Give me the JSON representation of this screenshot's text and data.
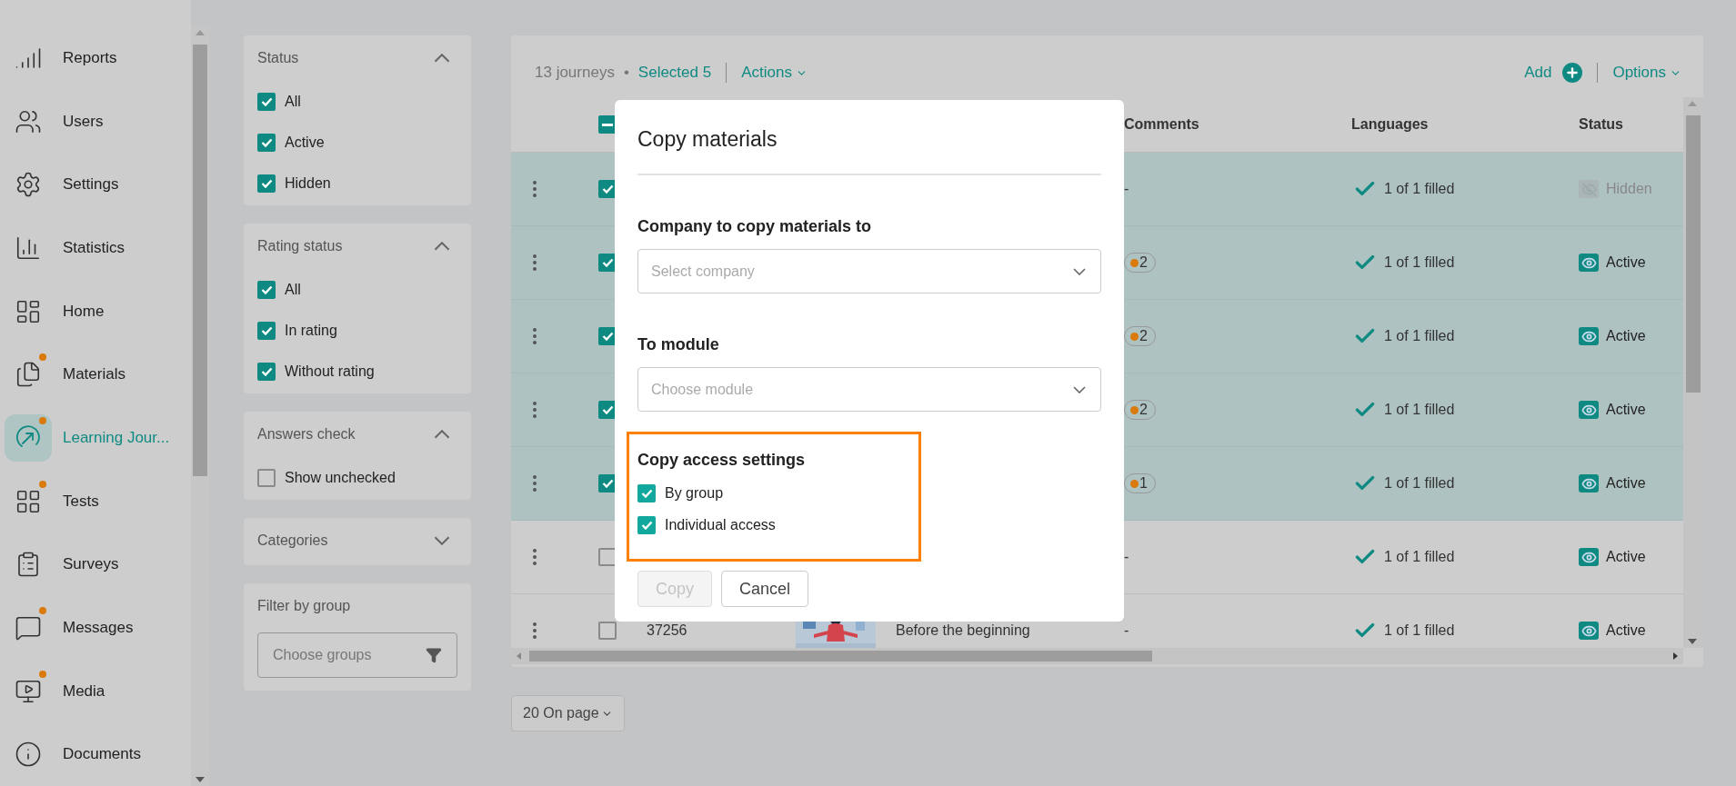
{
  "sidebar": {
    "items": [
      {
        "label": "Reports",
        "active": false,
        "badge": false
      },
      {
        "label": "Users",
        "active": false,
        "badge": false
      },
      {
        "label": "Settings",
        "active": false,
        "badge": false
      },
      {
        "label": "Statistics",
        "active": false,
        "badge": false
      },
      {
        "label": "Home",
        "active": false,
        "badge": false
      },
      {
        "label": "Materials",
        "active": false,
        "badge": true
      },
      {
        "label": "Learning Jour...",
        "active": true,
        "badge": true
      },
      {
        "label": "Tests",
        "active": false,
        "badge": true
      },
      {
        "label": "Surveys",
        "active": false,
        "badge": false
      },
      {
        "label": "Messages",
        "active": false,
        "badge": true
      },
      {
        "label": "Media",
        "active": false,
        "badge": true
      },
      {
        "label": "Documents",
        "active": false,
        "badge": false
      }
    ]
  },
  "filters": [
    {
      "kind": "checklist",
      "title": "Status",
      "expanded": true,
      "options": [
        {
          "label": "All",
          "checked": true
        },
        {
          "label": "Active",
          "checked": true
        },
        {
          "label": "Hidden",
          "checked": true
        }
      ]
    },
    {
      "kind": "checklist",
      "title": "Rating status",
      "expanded": true,
      "options": [
        {
          "label": "All",
          "checked": true
        },
        {
          "label": "In rating",
          "checked": true
        },
        {
          "label": "Without rating",
          "checked": true
        }
      ]
    },
    {
      "kind": "checklist",
      "title": "Answers check",
      "expanded": true,
      "options": [
        {
          "label": "Show unchecked",
          "checked": false
        }
      ]
    },
    {
      "kind": "checklist",
      "title": "Categories",
      "expanded": false
    },
    {
      "kind": "field",
      "title": "Filter by group",
      "placeholder": "Choose groups"
    }
  ],
  "table": {
    "count": "13 journeys",
    "separator": "•",
    "selected_count": "Selected 5",
    "actions": "Actions",
    "add": "Add",
    "options": "Options",
    "select_all_partial": true,
    "columns": [
      "Comments",
      "Languages",
      "Status"
    ],
    "rows": [
      {
        "selected": true,
        "comment": {
          "kind": "text",
          "text": "-"
        },
        "languages": "1 of 1 filled",
        "status": {
          "kind": "hidden",
          "label": "Hidden"
        }
      },
      {
        "selected": true,
        "comment": {
          "kind": "badge",
          "text": "2"
        },
        "languages": "1 of 1 filled",
        "status": {
          "kind": "active",
          "label": "Active"
        }
      },
      {
        "selected": true,
        "comment": {
          "kind": "badge",
          "text": "2"
        },
        "languages": "1 of 1 filled",
        "status": {
          "kind": "active",
          "label": "Active"
        }
      },
      {
        "selected": true,
        "comment": {
          "kind": "badge",
          "text": "2"
        },
        "languages": "1 of 1 filled",
        "status": {
          "kind": "active",
          "label": "Active"
        }
      },
      {
        "selected": true,
        "comment": {
          "kind": "badge",
          "text": "1"
        },
        "languages": "1 of 1 filled",
        "status": {
          "kind": "active",
          "label": "Active"
        }
      },
      {
        "selected": false,
        "comment": {
          "kind": "text",
          "text": "-"
        },
        "languages": "1 of 1 filled",
        "status": {
          "kind": "active",
          "label": "Active"
        }
      },
      {
        "selected": false,
        "id": "37256",
        "title": "Before the beginning",
        "comment": {
          "kind": "text",
          "text": "-"
        },
        "languages": "1 of 1 filled",
        "status": {
          "kind": "active",
          "label": "Active"
        }
      }
    ]
  },
  "pagination": {
    "label": "20 On page"
  },
  "modal": {
    "title": "Copy materials",
    "fields": [
      {
        "label": "Company to copy materials to",
        "placeholder": "Select company"
      },
      {
        "label": "To module",
        "placeholder": "Choose module"
      }
    ],
    "access": {
      "title": "Copy access settings",
      "highlighted": true,
      "options": [
        {
          "label": "By group",
          "checked": true
        },
        {
          "label": "Individual access",
          "checked": true
        }
      ]
    },
    "buttons": [
      {
        "label": "Copy",
        "disabled": true
      },
      {
        "label": "Cancel",
        "disabled": false
      }
    ]
  }
}
